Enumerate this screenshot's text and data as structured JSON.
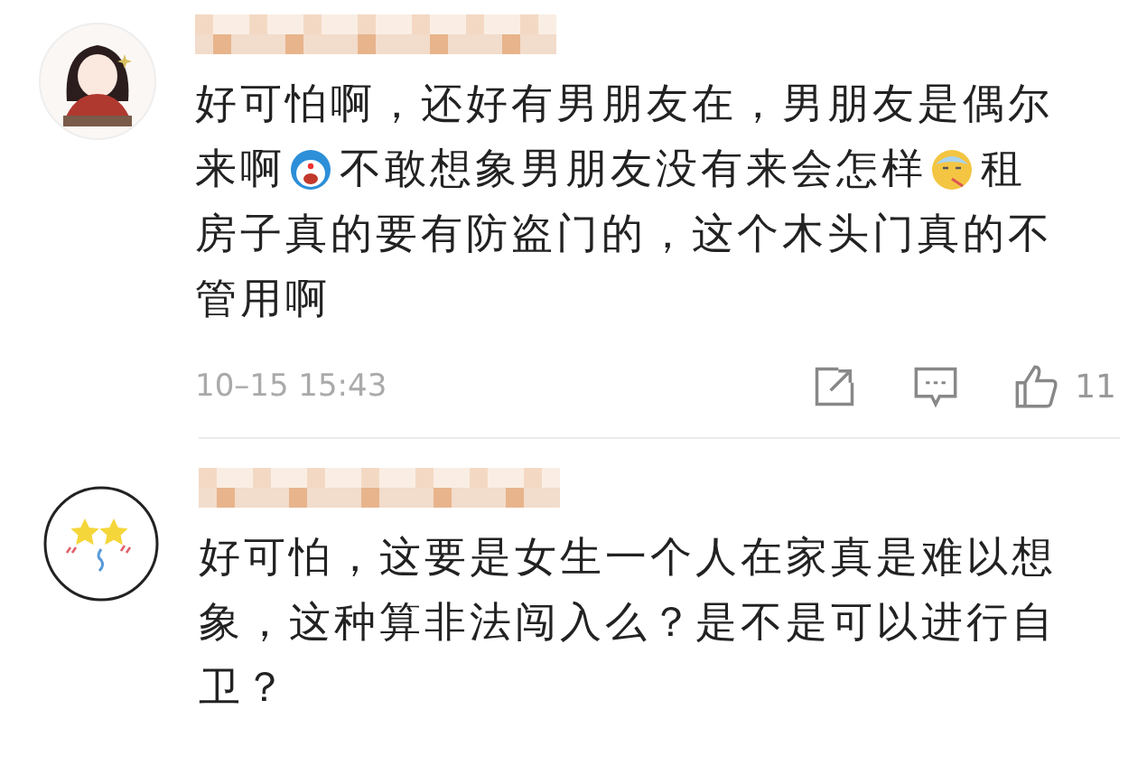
{
  "comments": [
    {
      "avatar": {
        "kind": "figure"
      },
      "lines": [
        [
          {
            "kind": "text",
            "text": "好可怕啊，还好有男朋友在，男朋友是偶尔"
          }
        ],
        [
          {
            "kind": "text",
            "text": "来啊"
          },
          {
            "kind": "blueface"
          },
          {
            "kind": "text",
            "text": "不敢想象男朋友没有来会怎样"
          },
          {
            "kind": "sick"
          },
          {
            "kind": "text",
            "text": "租"
          }
        ],
        [
          {
            "kind": "text",
            "text": "房子真的要有防盗门的，这个木头门真的不"
          }
        ],
        [
          {
            "kind": "text",
            "text": "管用啊"
          }
        ]
      ],
      "time": "10–15 15:43",
      "likes": "11"
    },
    {
      "avatar": {
        "kind": "stars"
      },
      "lines": [
        [
          {
            "kind": "text",
            "text": "好可怕，这要是女生一个人在家真是难以想"
          }
        ],
        [
          {
            "kind": "text",
            "text": "象，这种算非法闯入么？是不是可以进行自"
          }
        ],
        [
          {
            "kind": "text",
            "text": "卫？"
          }
        ]
      ]
    }
  ]
}
